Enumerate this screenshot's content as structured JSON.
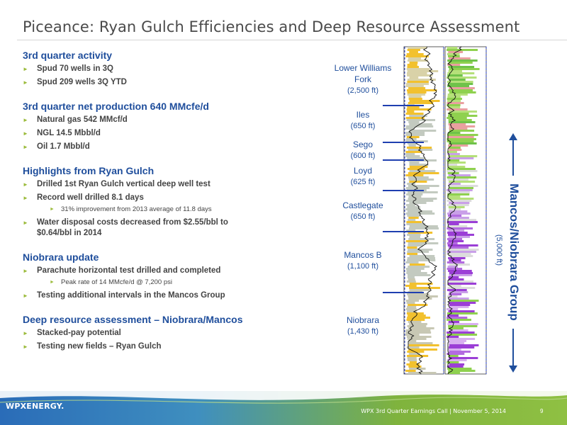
{
  "title": "Piceance: Ryan Gulch Efficiencies and Deep Resource Assessment",
  "sections": [
    {
      "heading": "3rd quarter activity",
      "bullets": [
        {
          "text": "Spud 70 wells in 3Q",
          "subs": []
        },
        {
          "text": "Spud 209 wells 3Q YTD",
          "subs": []
        }
      ]
    },
    {
      "heading": "3rd quarter net production 640 MMcfe/d",
      "bullets": [
        {
          "text": "Natural gas 542 MMcf/d",
          "subs": []
        },
        {
          "text": "NGL 14.5 Mbbl/d",
          "subs": []
        },
        {
          "text": "Oil 1.7 Mbbl/d",
          "subs": []
        }
      ]
    },
    {
      "heading": "Highlights from Ryan Gulch",
      "bullets": [
        {
          "text": "Drilled 1st Ryan Gulch vertical deep well test",
          "subs": []
        },
        {
          "text": "Record well drilled 8.1 days",
          "subs": [
            "31% improvement from 2013 average of 11.8 days"
          ]
        },
        {
          "text": "Water disposal costs decreased from $2.55/bbl to $0.64/bbl in 2014",
          "subs": []
        }
      ]
    },
    {
      "heading": "Niobrara update",
      "bullets": [
        {
          "text": "Parachute horizontal test drilled and completed",
          "subs": [
            "Peak rate of 14 MMcfe/d @ 7,200 psi"
          ]
        },
        {
          "text": "Testing additional intervals in the Mancos Group",
          "subs": []
        }
      ]
    },
    {
      "heading": "Deep resource assessment – Niobrara/Mancos",
      "bullets": [
        {
          "text": "Stacked-pay potential",
          "subs": []
        },
        {
          "text": "Testing new fields – Ryan Gulch",
          "subs": []
        }
      ]
    }
  ],
  "formations": [
    {
      "name": "Lower Williams Fork",
      "thickness": "(2,500 ft)"
    },
    {
      "name": "Iles",
      "thickness": "(650 ft)"
    },
    {
      "name": "Sego",
      "thickness": "(600 ft)"
    },
    {
      "name": "Loyd",
      "thickness": "(625 ft)"
    },
    {
      "name": "Castlegate",
      "thickness": "(650 ft)"
    },
    {
      "name": "Mancos B",
      "thickness": "(1,100 ft)"
    },
    {
      "name": "Niobrara",
      "thickness": "(1,430 ft)"
    }
  ],
  "group": {
    "name": "Mancos/Niobrara Group",
    "thickness": "(5,000 ft)"
  },
  "footer": {
    "logo": "WPXENERGY.",
    "caption": "WPX 3rd Quarter Earnings Call  |  November 5, 2014",
    "page": "9"
  },
  "colors": {
    "heading": "#1f4e9c",
    "bullet_arrow": "#9bbb3a",
    "footer_green": "#7fb33d",
    "footer_blue": "#2a6cb8"
  }
}
